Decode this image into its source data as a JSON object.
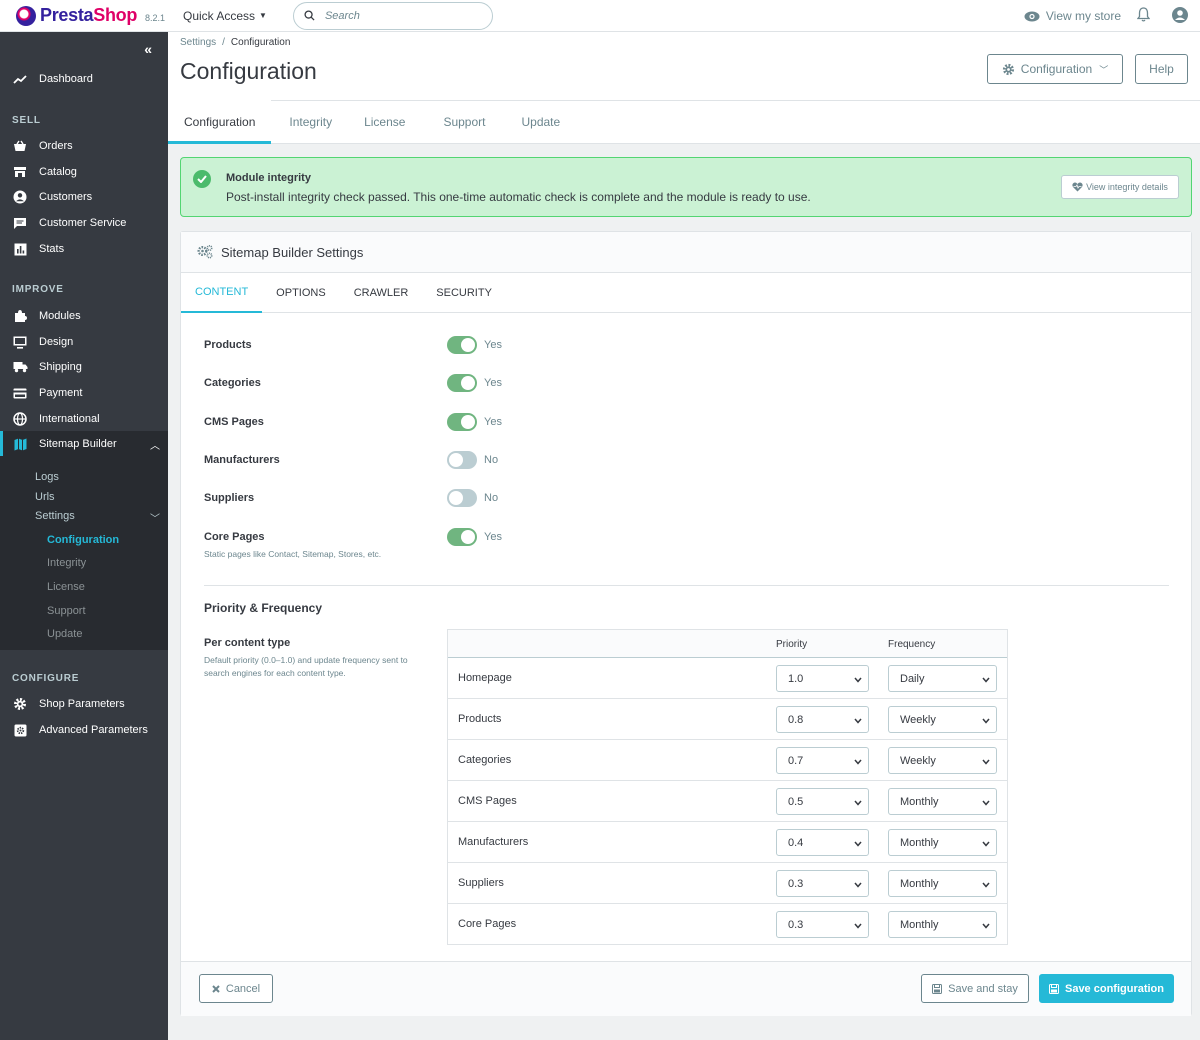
{
  "app": {
    "logo_presta": "Presta",
    "logo_shop": "Shop",
    "version": "8.2.1",
    "quick_access": "Quick Access",
    "search_placeholder": "Search",
    "view_store": "View my store"
  },
  "sidebar": {
    "dashboard": "Dashboard",
    "sections": {
      "sell": "SELL",
      "improve": "IMPROVE",
      "configure": "CONFIGURE"
    },
    "sell_items": [
      "Orders",
      "Catalog",
      "Customers",
      "Customer Service",
      "Stats"
    ],
    "improve_items": [
      "Modules",
      "Design",
      "Shipping",
      "Payment",
      "International",
      "Sitemap Builder"
    ],
    "sitemap_sub": [
      "Logs",
      "Urls",
      "Settings"
    ],
    "settings_sub": [
      "Configuration",
      "Integrity",
      "License",
      "Support",
      "Update"
    ],
    "configure_items": [
      "Shop Parameters",
      "Advanced Parameters"
    ]
  },
  "header": {
    "breadcrumb": [
      "Settings",
      "Configuration"
    ],
    "title": "Configuration",
    "config_button": "Configuration",
    "help_button": "Help"
  },
  "page_tabs": [
    "Configuration",
    "Integrity",
    "License",
    "Support",
    "Update"
  ],
  "alert": {
    "title": "Module integrity",
    "message": "Post-install integrity check passed. This one-time automatic check is complete and the module is ready to use.",
    "button": "View integrity details"
  },
  "card": {
    "title": "Sitemap Builder Settings",
    "tabs": [
      "CONTENT",
      "OPTIONS",
      "CRAWLER",
      "SECURITY"
    ],
    "toggles": [
      {
        "label": "Products",
        "state": "Yes",
        "on": true
      },
      {
        "label": "Categories",
        "state": "Yes",
        "on": true
      },
      {
        "label": "CMS Pages",
        "state": "Yes",
        "on": true
      },
      {
        "label": "Manufacturers",
        "state": "No",
        "on": false
      },
      {
        "label": "Suppliers",
        "state": "No",
        "on": false
      },
      {
        "label": "Core Pages",
        "state": "Yes",
        "on": true,
        "help": "Static pages like Contact, Sitemap, Stores, etc."
      }
    ],
    "priority_section": "Priority & Frequency",
    "per_type_label": "Per content type",
    "per_type_help": "Default priority (0.0–1.0) and update frequency sent to search engines for each content type.",
    "table_headers": {
      "priority": "Priority",
      "frequency": "Frequency"
    },
    "rows": [
      {
        "label": "Homepage",
        "priority": "1.0",
        "frequency": "Daily"
      },
      {
        "label": "Products",
        "priority": "0.8",
        "frequency": "Weekly"
      },
      {
        "label": "Categories",
        "priority": "0.7",
        "frequency": "Weekly"
      },
      {
        "label": "CMS Pages",
        "priority": "0.5",
        "frequency": "Monthly"
      },
      {
        "label": "Manufacturers",
        "priority": "0.4",
        "frequency": "Monthly"
      },
      {
        "label": "Suppliers",
        "priority": "0.3",
        "frequency": "Monthly"
      },
      {
        "label": "Core Pages",
        "priority": "0.3",
        "frequency": "Monthly"
      }
    ],
    "footer": {
      "cancel": "Cancel",
      "save_stay": "Save and stay",
      "save": "Save configuration"
    }
  },
  "colors": {
    "accent": "#25b9d7",
    "sidebar": "#363a41",
    "success_bg": "#cbf2d4",
    "toggle_on": "#70b580"
  }
}
